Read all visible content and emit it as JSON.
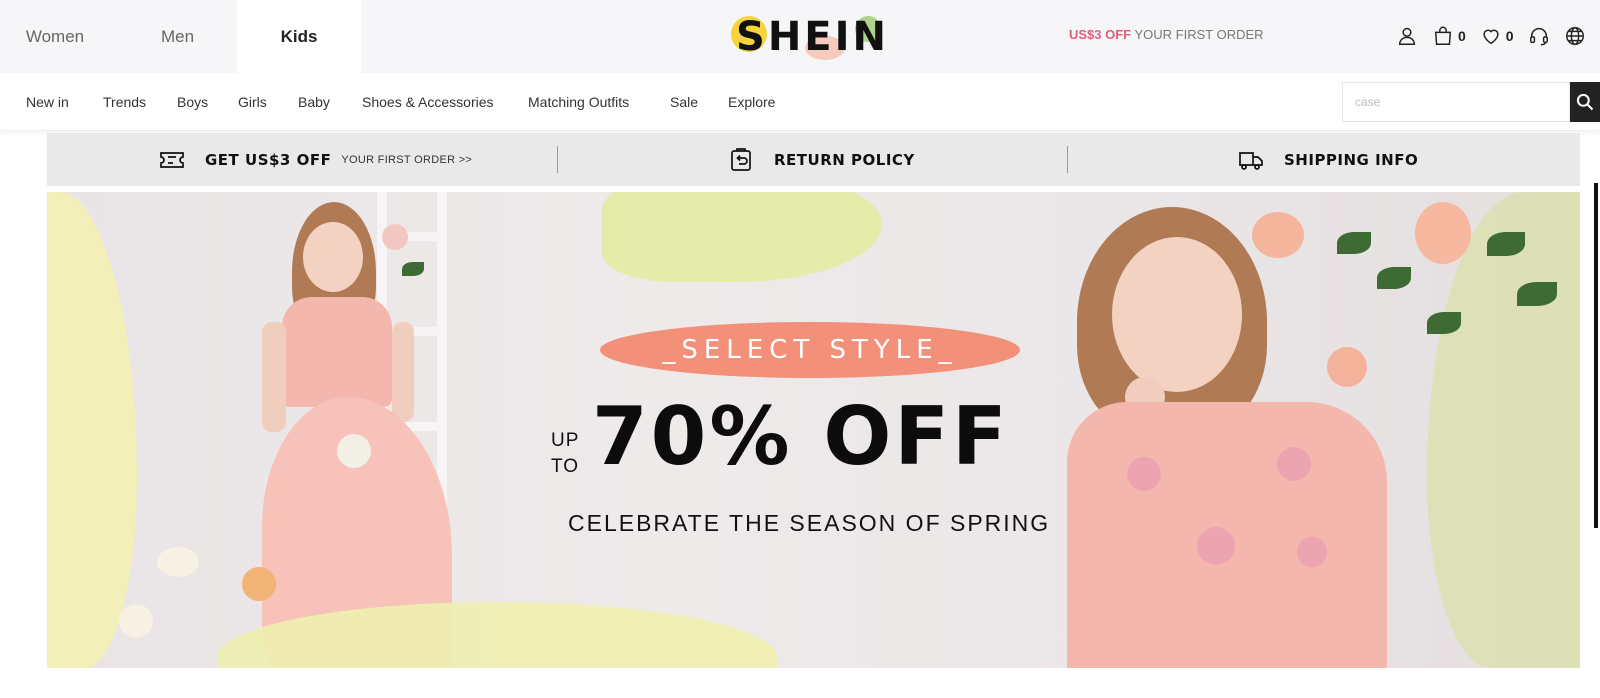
{
  "top_bar": {
    "categories": [
      {
        "label": "Women",
        "selected": false
      },
      {
        "label": "Men",
        "selected": false
      },
      {
        "label": "Kids",
        "selected": true
      }
    ],
    "logo_text": "SHEIN",
    "promo": {
      "accent": "US$3 OFF",
      "rest": "YOUR FIRST ORDER"
    },
    "icons": [
      {
        "name": "user-icon"
      },
      {
        "name": "bag-icon",
        "count": "0"
      },
      {
        "name": "heart-icon",
        "count": "0"
      },
      {
        "name": "headset-icon"
      },
      {
        "name": "globe-icon"
      }
    ]
  },
  "nav": {
    "items": [
      "New in",
      "Trends",
      "Boys",
      "Girls",
      "Baby",
      "Shoes & Accessories",
      "Matching Outfits",
      "Sale",
      "Explore"
    ],
    "search_placeholder": "case"
  },
  "info_strip": {
    "items": [
      {
        "title": "GET US$3 OFF",
        "subtitle": "YOUR FIRST ORDER >>",
        "icon": "coupon-icon"
      },
      {
        "title": "RETURN POLICY",
        "subtitle": "",
        "icon": "return-icon"
      },
      {
        "title": "SHIPPING INFO",
        "subtitle": "",
        "icon": "truck-icon"
      }
    ]
  },
  "banner": {
    "tagline": "_SELECT STYLE_",
    "up": "UP",
    "to": "TO",
    "headline": "70% OFF",
    "subheadline": "CELEBRATE THE SEASON OF SPRING",
    "colors": {
      "ribbon": "#f2907a",
      "pastel_yellow": "#f4f0b2",
      "pastel_green": "#e5eba9"
    }
  },
  "colors": {
    "accent": "#e0607a",
    "dark": "#222222"
  }
}
